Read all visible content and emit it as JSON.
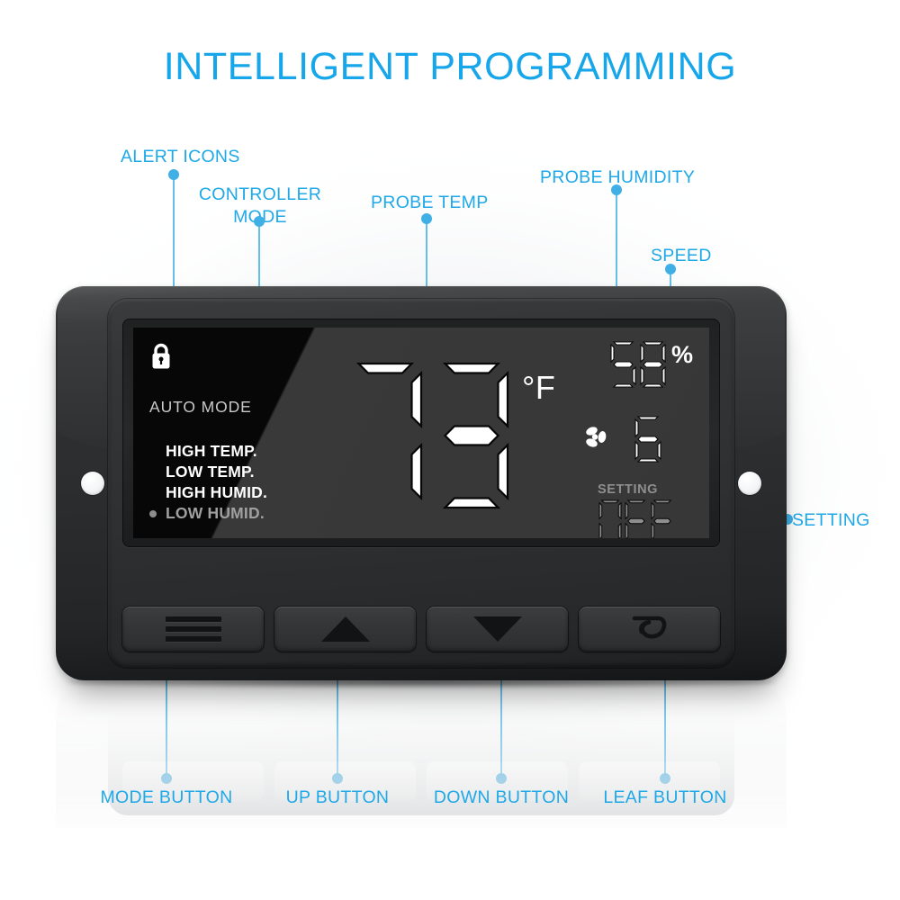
{
  "header": {
    "title": "INTELLIGENT PROGRAMMING",
    "accent_color": "#1FA8E8"
  },
  "callouts": {
    "alert_icons": "ALERT ICONS",
    "controller_mode_line1": "CONTROLLER",
    "controller_mode_line2": "MODE",
    "probe_temp": "PROBE TEMP",
    "probe_humidity": "PROBE HUMIDITY",
    "speed": "SPEED",
    "setting": "SETTING",
    "mode_button": "MODE BUTTON",
    "up_button": "UP BUTTON",
    "down_button": "DOWN BUTTON",
    "leaf_button": "LEAF BUTTON"
  },
  "display": {
    "lock_icon": "lock-icon",
    "mode_text": "AUTO MODE",
    "alerts": [
      {
        "label": "HIGH TEMP.",
        "active": false
      },
      {
        "label": "LOW TEMP.",
        "active": false
      },
      {
        "label": "HIGH HUMID.",
        "active": false
      },
      {
        "label": "LOW HUMID.",
        "active": true
      }
    ],
    "temperature": "73",
    "temperature_unit": "°F",
    "humidity": "58",
    "humidity_unit": "%",
    "fan_icon": "fan-icon",
    "fan_speed": "6",
    "setting_label": "SETTING",
    "setting_value": "OFF",
    "colors": {
      "screen_bg": "#070707",
      "glare": "#3a3a3a",
      "segment_on": "#ffffff",
      "segment_dim": "#8e8e8e",
      "text_dim": "#c9c9c9"
    }
  },
  "buttons": [
    {
      "name": "mode-button",
      "icon": "hamburger-icon"
    },
    {
      "name": "up-button",
      "icon": "triangle-up-icon"
    },
    {
      "name": "down-button",
      "icon": "triangle-down-icon"
    },
    {
      "name": "leaf-button",
      "icon": "leaf-icon"
    }
  ]
}
